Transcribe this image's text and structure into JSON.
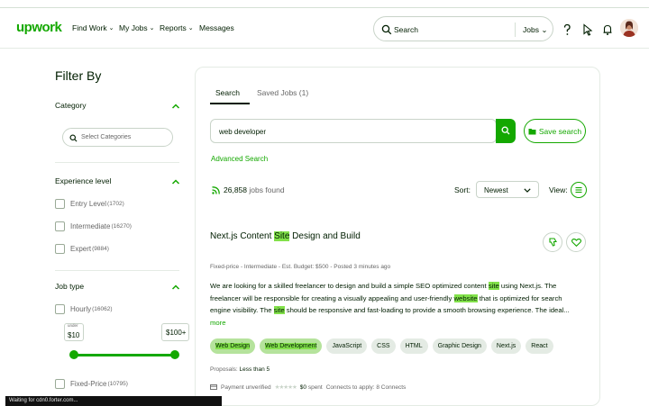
{
  "brand": {
    "logo": "upwork",
    "accent": "#14a800",
    "highlight": "#82e14a"
  },
  "nav": {
    "items": [
      {
        "label": "Find Work",
        "has_menu": true
      },
      {
        "label": "My Jobs",
        "has_menu": true
      },
      {
        "label": "Reports",
        "has_menu": true
      },
      {
        "label": "Messages",
        "has_menu": false
      }
    ],
    "search_placeholder": "Search",
    "search_scope": "Jobs"
  },
  "filters": {
    "title": "Filter By",
    "category": {
      "title": "Category",
      "select_placeholder": "Select Categories"
    },
    "experience": {
      "title": "Experience level",
      "options": [
        {
          "label": "Entry Level",
          "count": "(1702)"
        },
        {
          "label": "Intermediate",
          "count": "(16270)"
        },
        {
          "label": "Expert",
          "count": "(9884)"
        }
      ]
    },
    "job_type": {
      "title": "Job type",
      "hourly": {
        "label": "Hourly",
        "count": "(16062)"
      },
      "rate_min_label": "under",
      "rate_min": "$10",
      "rate_max": "$100+",
      "fixed": {
        "label": "Fixed-Price",
        "count": "(10795)"
      }
    }
  },
  "main": {
    "tabs": [
      {
        "label": "Search"
      },
      {
        "label": "Saved Jobs (1)"
      }
    ],
    "query": "web developer",
    "save_search": "Save search",
    "advanced_search": "Advanced Search",
    "jobs_found_count": "26,858",
    "jobs_found_text": "jobs found",
    "sort_label": "Sort:",
    "sort_value": "Newest",
    "view_label": "View:"
  },
  "job": {
    "title_pre": "Next.js Content ",
    "title_hl": "Site",
    "title_post": " Design and Build",
    "meta": "Fixed-price - Intermediate - Est. Budget: $500 - Posted 3 minutes ago",
    "desc_1": "We are looking for a skilled freelancer to design and build a simple SEO optimized content ",
    "desc_hl1": "site",
    "desc_2": " using Next.js. The freelancer will be responsible for creating a visually appealing and user-friendly ",
    "desc_hl2": "website",
    "desc_3": " that is optimized for search engine visibility. The ",
    "desc_hl3": "site",
    "desc_4": " should be responsive and fast-loading to provide a smooth browsing experience. The ideal...",
    "more": "more",
    "skills": [
      {
        "label": "Web Design",
        "highlighted": true
      },
      {
        "label": "Web Development",
        "highlighted": true
      },
      {
        "label": "JavaScript",
        "highlighted": false
      },
      {
        "label": "CSS",
        "highlighted": false
      },
      {
        "label": "HTML",
        "highlighted": false
      },
      {
        "label": "Graphic Design",
        "highlighted": false
      },
      {
        "label": "Next.js",
        "highlighted": false
      },
      {
        "label": "React",
        "highlighted": false
      }
    ],
    "proposals_label": "Proposals:",
    "proposals_value": "Less than 5",
    "payment": "Payment unverified",
    "spent_amount": "$0",
    "spent_text": "spent",
    "connects": "Connects to apply: 8 Connects"
  },
  "status_bar": "Waiting for cdn0.forter.com..."
}
